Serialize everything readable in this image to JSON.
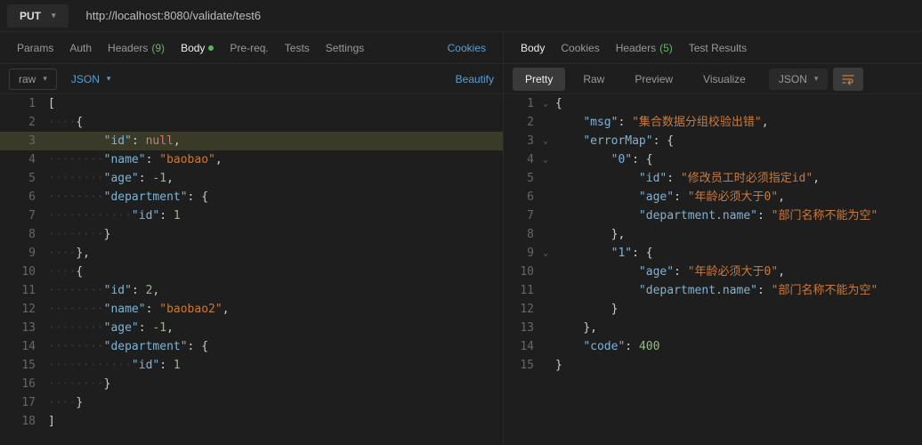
{
  "request": {
    "method": "PUT",
    "url": "http://localhost:8080/validate/test6"
  },
  "leftTabs": {
    "params": "Params",
    "auth": "Auth",
    "headers": "Headers",
    "headersCount": "(9)",
    "body": "Body",
    "prereq": "Pre-req.",
    "tests": "Tests",
    "settings": "Settings",
    "cookies": "Cookies"
  },
  "leftSub": {
    "raw": "raw",
    "json": "JSON",
    "beautify": "Beautify"
  },
  "rightTabs": {
    "body": "Body",
    "cookies": "Cookies",
    "headers": "Headers",
    "headersCount": "(5)",
    "testResults": "Test Results"
  },
  "rightSub": {
    "pretty": "Pretty",
    "raw": "Raw",
    "preview": "Preview",
    "visualize": "Visualize",
    "json": "JSON"
  },
  "reqBody": [
    [
      {
        "c": "p",
        "t": "["
      }
    ],
    [
      {
        "c": "ws",
        "t": "····"
      },
      {
        "c": "p",
        "t": "{"
      }
    ],
    [
      {
        "c": "ws",
        "t": "········"
      },
      {
        "c": "k",
        "t": "\"id\""
      },
      {
        "c": "p",
        "t": ": "
      },
      {
        "c": "null",
        "t": "null"
      },
      {
        "c": "p",
        "t": ","
      }
    ],
    [
      {
        "c": "ws",
        "t": "········"
      },
      {
        "c": "k",
        "t": "\"name\""
      },
      {
        "c": "p",
        "t": ": "
      },
      {
        "c": "s",
        "t": "\"baobao\""
      },
      {
        "c": "p",
        "t": ","
      }
    ],
    [
      {
        "c": "ws",
        "t": "········"
      },
      {
        "c": "k",
        "t": "\"age\""
      },
      {
        "c": "p",
        "t": ": "
      },
      {
        "c": "n",
        "t": "-1"
      },
      {
        "c": "p",
        "t": ","
      }
    ],
    [
      {
        "c": "ws",
        "t": "········"
      },
      {
        "c": "k",
        "t": "\"department\""
      },
      {
        "c": "p",
        "t": ": {"
      }
    ],
    [
      {
        "c": "ws",
        "t": "············"
      },
      {
        "c": "k",
        "t": "\"id\""
      },
      {
        "c": "p",
        "t": ": "
      },
      {
        "c": "n",
        "t": "1"
      }
    ],
    [
      {
        "c": "ws",
        "t": "········"
      },
      {
        "c": "p",
        "t": "}"
      }
    ],
    [
      {
        "c": "ws",
        "t": "····"
      },
      {
        "c": "p",
        "t": "},"
      }
    ],
    [
      {
        "c": "ws",
        "t": "····"
      },
      {
        "c": "p",
        "t": "{"
      }
    ],
    [
      {
        "c": "ws",
        "t": "········"
      },
      {
        "c": "k",
        "t": "\"id\""
      },
      {
        "c": "p",
        "t": ": "
      },
      {
        "c": "n",
        "t": "2"
      },
      {
        "c": "p",
        "t": ","
      }
    ],
    [
      {
        "c": "ws",
        "t": "········"
      },
      {
        "c": "k",
        "t": "\"name\""
      },
      {
        "c": "p",
        "t": ": "
      },
      {
        "c": "s",
        "t": "\"baobao2\""
      },
      {
        "c": "p",
        "t": ","
      }
    ],
    [
      {
        "c": "ws",
        "t": "········"
      },
      {
        "c": "k",
        "t": "\"age\""
      },
      {
        "c": "p",
        "t": ": "
      },
      {
        "c": "n",
        "t": "-1"
      },
      {
        "c": "p",
        "t": ","
      }
    ],
    [
      {
        "c": "ws",
        "t": "········"
      },
      {
        "c": "k",
        "t": "\"department\""
      },
      {
        "c": "p",
        "t": ": {"
      }
    ],
    [
      {
        "c": "ws",
        "t": "············"
      },
      {
        "c": "k",
        "t": "\"id\""
      },
      {
        "c": "p",
        "t": ": "
      },
      {
        "c": "n",
        "t": "1"
      }
    ],
    [
      {
        "c": "ws",
        "t": "········"
      },
      {
        "c": "p",
        "t": "}"
      }
    ],
    [
      {
        "c": "ws",
        "t": "····"
      },
      {
        "c": "p",
        "t": "}"
      }
    ],
    [
      {
        "c": "p",
        "t": "]"
      }
    ]
  ],
  "reqHighlight": 3,
  "respBody": [
    {
      "fold": "⌄",
      "toks": [
        {
          "c": "p",
          "t": "{"
        }
      ]
    },
    {
      "fold": "",
      "toks": [
        {
          "c": "ws",
          "t": "    "
        },
        {
          "c": "k",
          "t": "\"msg\""
        },
        {
          "c": "p",
          "t": ": "
        },
        {
          "c": "s",
          "t": "\"集合数据分组校验出错\""
        },
        {
          "c": "p",
          "t": ","
        }
      ]
    },
    {
      "fold": "⌄",
      "toks": [
        {
          "c": "ws",
          "t": "    "
        },
        {
          "c": "k",
          "t": "\"errorMap\""
        },
        {
          "c": "p",
          "t": ": {"
        }
      ]
    },
    {
      "fold": "⌄",
      "toks": [
        {
          "c": "ws",
          "t": "        "
        },
        {
          "c": "k",
          "t": "\"0\""
        },
        {
          "c": "p",
          "t": ": {"
        }
      ]
    },
    {
      "fold": "",
      "toks": [
        {
          "c": "ws",
          "t": "            "
        },
        {
          "c": "k",
          "t": "\"id\""
        },
        {
          "c": "p",
          "t": ": "
        },
        {
          "c": "s",
          "t": "\"修改员工时必须指定id\""
        },
        {
          "c": "p",
          "t": ","
        }
      ]
    },
    {
      "fold": "",
      "toks": [
        {
          "c": "ws",
          "t": "            "
        },
        {
          "c": "k",
          "t": "\"age\""
        },
        {
          "c": "p",
          "t": ": "
        },
        {
          "c": "s",
          "t": "\"年龄必须大于0\""
        },
        {
          "c": "p",
          "t": ","
        }
      ]
    },
    {
      "fold": "",
      "toks": [
        {
          "c": "ws",
          "t": "            "
        },
        {
          "c": "k",
          "t": "\"department.name\""
        },
        {
          "c": "p",
          "t": ": "
        },
        {
          "c": "s",
          "t": "\"部门名称不能为空\""
        }
      ]
    },
    {
      "fold": "",
      "toks": [
        {
          "c": "ws",
          "t": "        "
        },
        {
          "c": "p",
          "t": "},"
        }
      ]
    },
    {
      "fold": "⌄",
      "toks": [
        {
          "c": "ws",
          "t": "        "
        },
        {
          "c": "k",
          "t": "\"1\""
        },
        {
          "c": "p",
          "t": ": {"
        }
      ]
    },
    {
      "fold": "",
      "toks": [
        {
          "c": "ws",
          "t": "            "
        },
        {
          "c": "k",
          "t": "\"age\""
        },
        {
          "c": "p",
          "t": ": "
        },
        {
          "c": "s",
          "t": "\"年龄必须大于0\""
        },
        {
          "c": "p",
          "t": ","
        }
      ]
    },
    {
      "fold": "",
      "toks": [
        {
          "c": "ws",
          "t": "            "
        },
        {
          "c": "k",
          "t": "\"department.name\""
        },
        {
          "c": "p",
          "t": ": "
        },
        {
          "c": "s",
          "t": "\"部门名称不能为空\""
        }
      ]
    },
    {
      "fold": "",
      "toks": [
        {
          "c": "ws",
          "t": "        "
        },
        {
          "c": "p",
          "t": "}"
        }
      ]
    },
    {
      "fold": "",
      "toks": [
        {
          "c": "ws",
          "t": "    "
        },
        {
          "c": "p",
          "t": "},"
        }
      ]
    },
    {
      "fold": "",
      "toks": [
        {
          "c": "ws",
          "t": "    "
        },
        {
          "c": "k",
          "t": "\"code\""
        },
        {
          "c": "p",
          "t": ": "
        },
        {
          "c": "n",
          "t": "400"
        }
      ]
    },
    {
      "fold": "",
      "toks": [
        {
          "c": "p",
          "t": "}"
        }
      ]
    }
  ]
}
